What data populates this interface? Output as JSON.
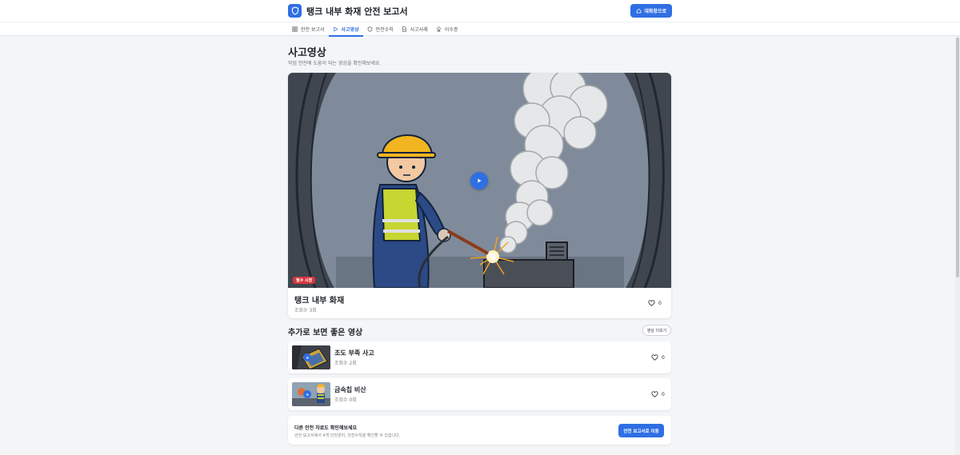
{
  "header": {
    "title": "탱크 내부 화재 안전 보고서",
    "home_button": "대화창으로",
    "accent": "#2f6fe4"
  },
  "tabs": [
    {
      "label": "안전 보고서",
      "icon": "grid-icon"
    },
    {
      "label": "사고영상",
      "icon": "play-icon",
      "active": true
    },
    {
      "label": "안전수칙",
      "icon": "shield-icon"
    },
    {
      "label": "사고사례",
      "icon": "document-icon"
    },
    {
      "label": "이수증",
      "icon": "award-icon"
    }
  ],
  "page": {
    "title": "사고영상",
    "subtitle": "작업 안전에 도움이 되는 영상을 확인해보세요."
  },
  "main_video": {
    "badge": "필수 시청",
    "title": "탱크 내부 화재",
    "views": "조회수 3회",
    "likes": "0"
  },
  "related": {
    "title": "추가로 보면 좋은 영상",
    "more_button": "영상 더보기",
    "items": [
      {
        "title": "조도 부족 사고",
        "views": "조회수 2회",
        "likes": "0"
      },
      {
        "title": "금속칩 비산",
        "views": "조회수 0회",
        "likes": "0"
      }
    ]
  },
  "cta": {
    "title": "다른 안전 자료도 확인해보세요",
    "desc": "안전 보고서에서 4개 안전관리, 안전수칙을 확인할 수 있습니다.",
    "button": "안전 보고서로 이동"
  }
}
